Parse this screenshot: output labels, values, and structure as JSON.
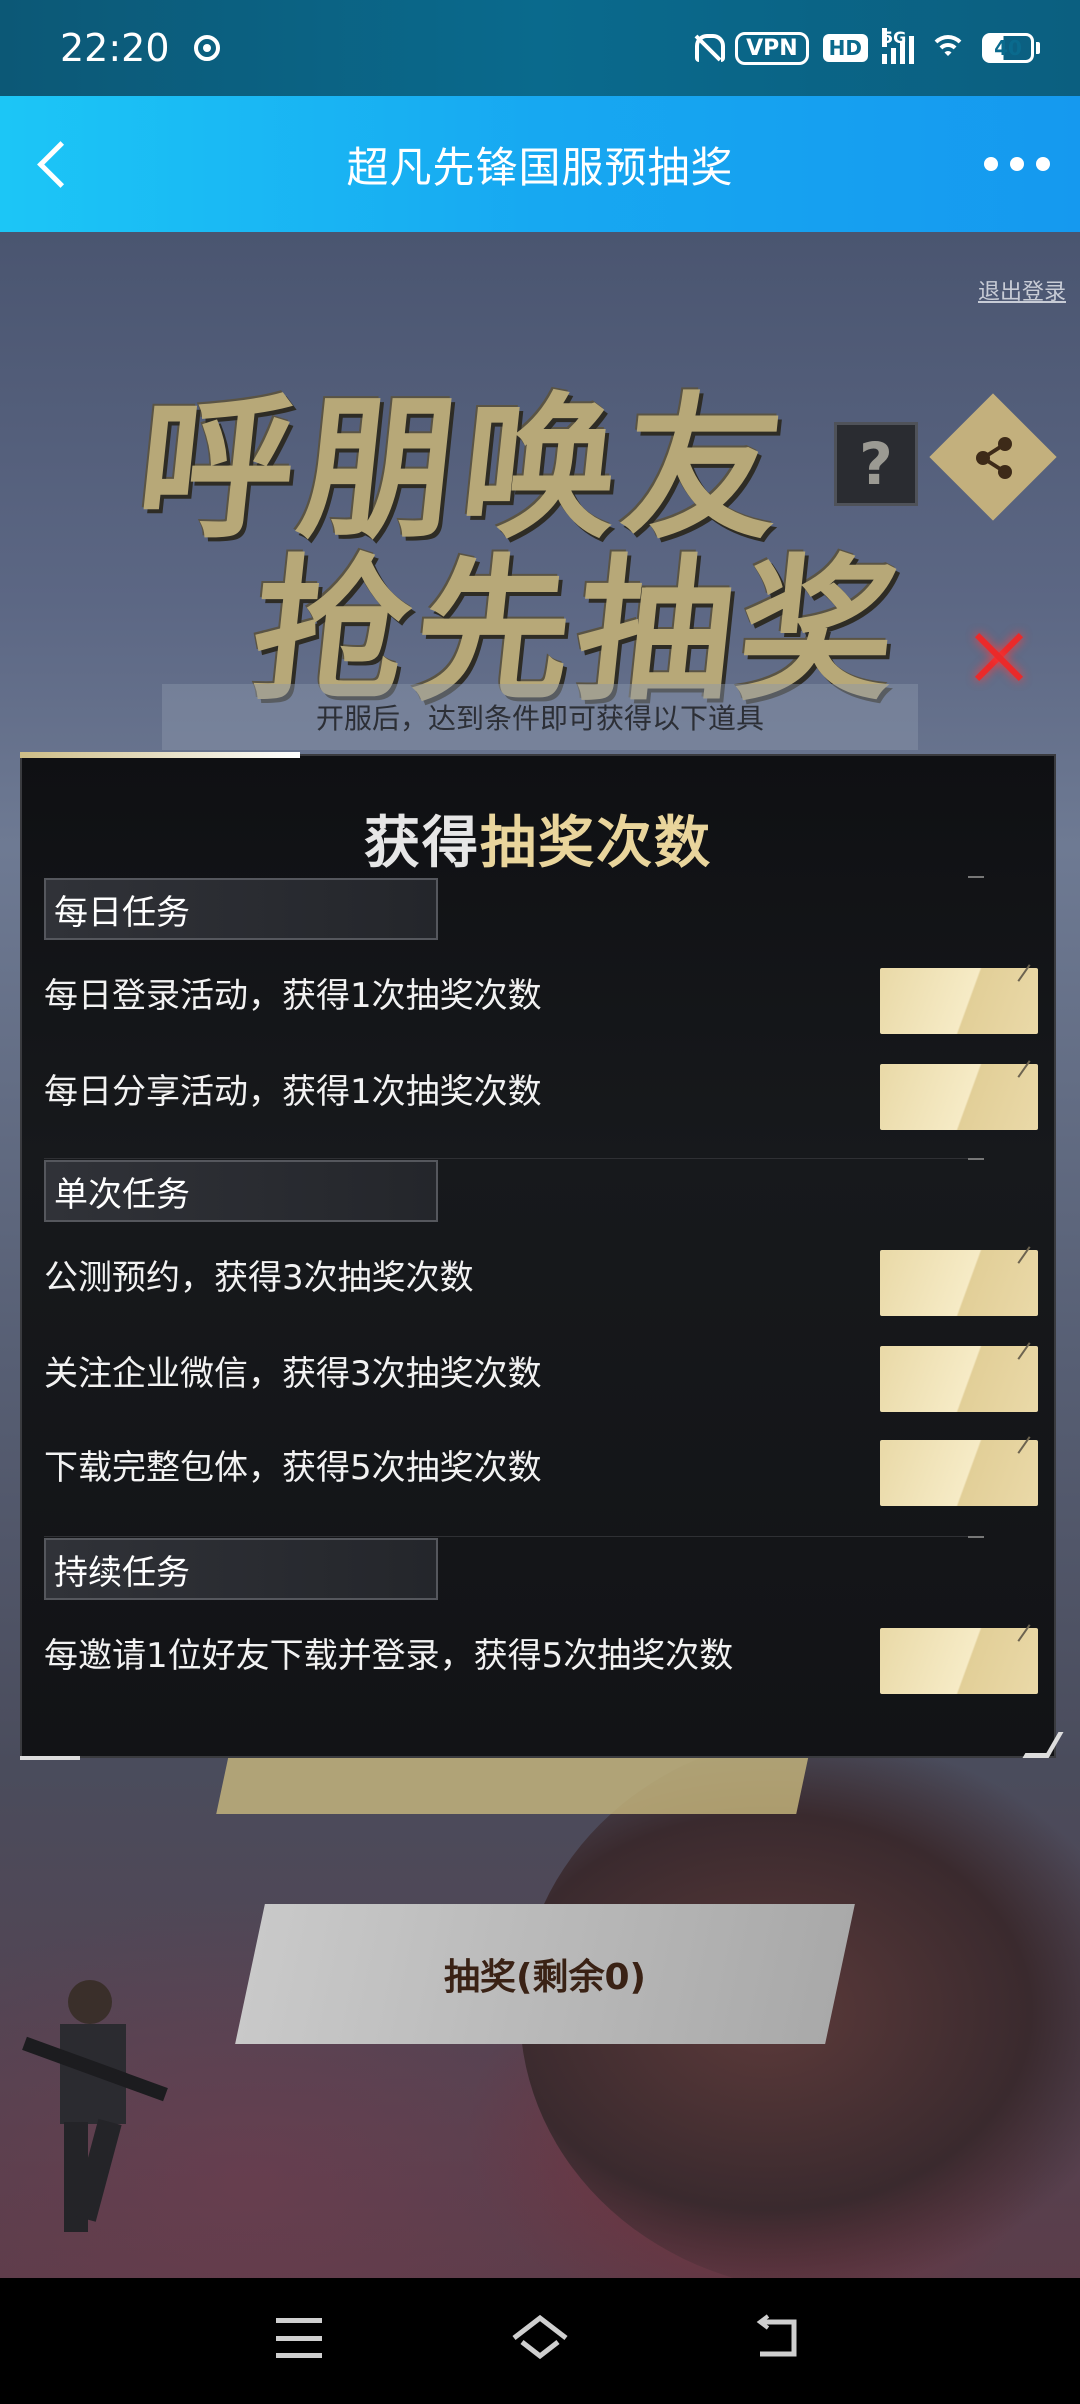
{
  "status_bar": {
    "time": "22:20",
    "vpn": "VPN",
    "hd": "HD",
    "network": "5G",
    "battery": "40"
  },
  "header": {
    "title": "超凡先锋国服预抽奖"
  },
  "game": {
    "logout": "退出登录",
    "hero_line1": "呼朋唤友",
    "hero_line2": "抢先抽奖",
    "help_mark": "?",
    "subtitle": "开服后，达到条件即可获得以下道具",
    "draw_button": "抽奖(剩余0)"
  },
  "modal": {
    "title_white": "获得",
    "title_gold": "抽奖次数",
    "sections": [
      {
        "label": "每日任务",
        "tasks": [
          "每日登录活动，获得1次抽奖次数",
          "每日分享活动，获得1次抽奖次数"
        ]
      },
      {
        "label": "单次任务",
        "tasks": [
          "公测预约，获得3次抽奖次数",
          "关注企业微信，获得3次抽奖次数",
          "下载完整包体，获得5次抽奖次数"
        ]
      },
      {
        "label": "持续任务",
        "tasks": [
          "每邀请1位好友下载并登录，获得5次抽奖次数"
        ]
      }
    ]
  },
  "colors": {
    "title_bar": "#17a8f1",
    "status_bar": "#0a6a8d",
    "gold": "#e9d59c",
    "close_red": "#ea2a2a"
  }
}
